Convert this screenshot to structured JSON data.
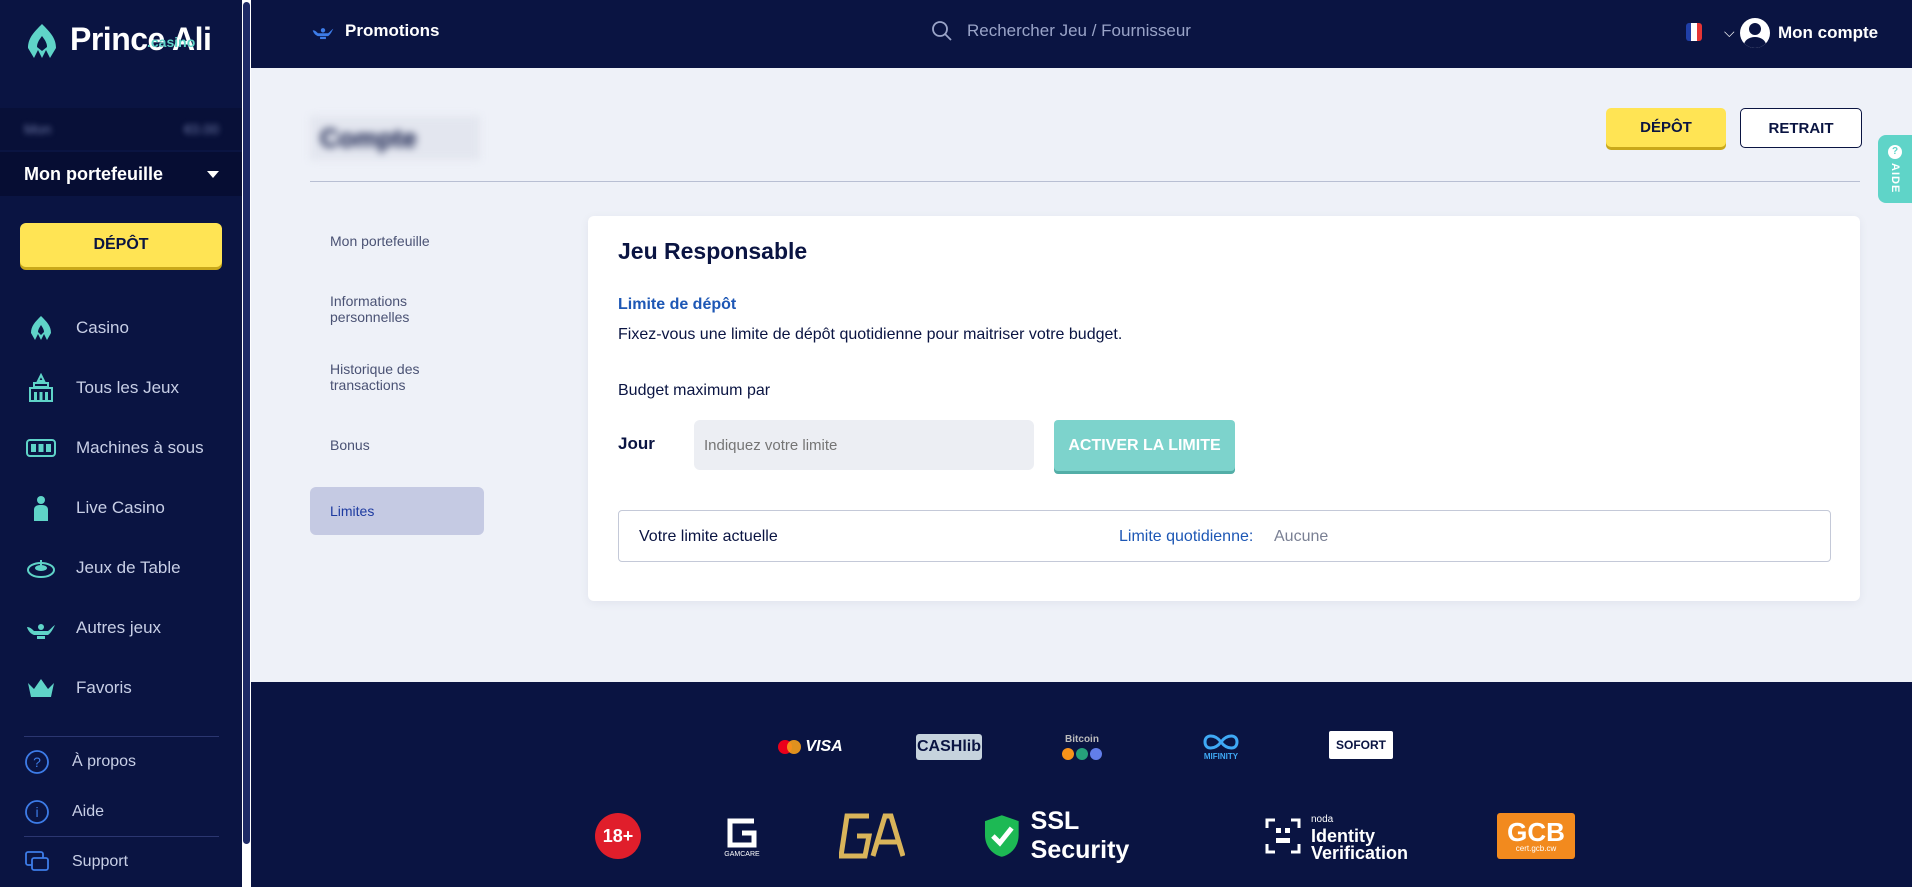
{
  "brand": {
    "name": "Prince Ali",
    "suffix": ".casino"
  },
  "sidebar": {
    "wallet_blurred_label": "Mon",
    "wallet_blurred_amount": "€0.00",
    "wallet_selector": "Mon portefeuille",
    "deposit_label": "DÉPÔT",
    "items": [
      {
        "label": "Casino",
        "icon": "casino-lamp-icon"
      },
      {
        "label": "Tous les Jeux",
        "icon": "palace-icon"
      },
      {
        "label": "Machines à sous",
        "icon": "slot-machine-icon"
      },
      {
        "label": "Live Casino",
        "icon": "dealer-icon"
      },
      {
        "label": "Jeux de Table",
        "icon": "roulette-icon"
      },
      {
        "label": "Autres jeux",
        "icon": "genie-lamp-icon"
      },
      {
        "label": "Favoris",
        "icon": "crown-icon"
      }
    ],
    "footer_items": [
      {
        "label": "À propos",
        "icon": "question-icon"
      },
      {
        "label": "Aide",
        "icon": "info-icon"
      },
      {
        "label": "Support",
        "icon": "chat-icon"
      }
    ]
  },
  "topbar": {
    "promotions": "Promotions",
    "search_placeholder": "Rechercher Jeu / Fournisseur",
    "account": "Mon compte"
  },
  "header": {
    "blurred_title": "Compte",
    "deposit": "DÉPÔT",
    "withdraw": "RETRAIT",
    "help_tab": "AIDE"
  },
  "subnav": [
    "Mon portefeuille",
    "Informations personnelles",
    "Historique des transactions",
    "Bonus",
    "Limites"
  ],
  "card": {
    "title": "Jeu Responsable",
    "limit_title": "Limite de dépôt",
    "limit_desc": "Fixez-vous une limite de dépôt quotidienne pour maitriser votre budget.",
    "budget_label": "Budget maximum par",
    "period": "Jour",
    "input_placeholder": "Indiquez votre limite",
    "activate": "ACTIVER LA LIMITE",
    "current_label": "Votre limite actuelle",
    "daily_label": "Limite quotidienne:",
    "daily_value": "Aucune"
  },
  "footer": {
    "payments": [
      "VISA",
      "CASHlib",
      "Bitcoin",
      "MIFINITY",
      "SOFORT"
    ],
    "badges": {
      "age": "18+",
      "gamcare": "GAMCARE",
      "ssl": "SSL Security",
      "noda": "noda",
      "identity": "Identity",
      "verification": "Verification",
      "gcb": "GCB",
      "gcb_sub": "cert.gcb.cw"
    }
  },
  "colors": {
    "navy": "#0a1442",
    "yellow": "#ffe454",
    "teal": "#5fd4c8",
    "blue": "#1d57b5"
  }
}
